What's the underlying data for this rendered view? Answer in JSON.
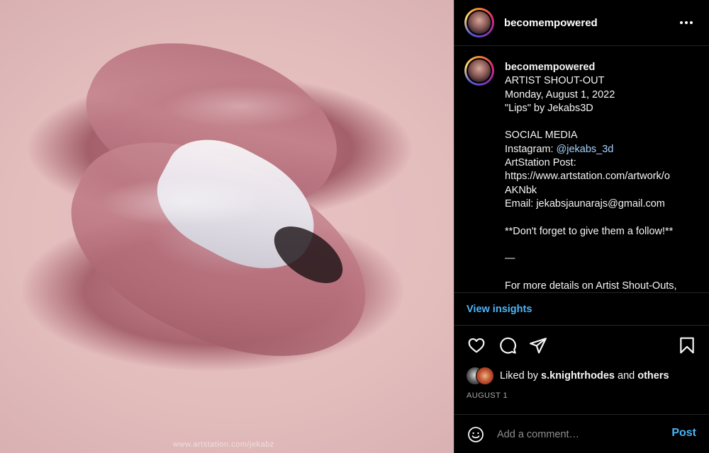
{
  "post": {
    "watermark": "www.artstation.com/jekabz"
  },
  "header": {
    "username": "becomempowered"
  },
  "caption": {
    "username": "becomempowered",
    "lines": [
      "ARTIST SHOUT-OUT",
      "Monday, August 1, 2022",
      "\"Lips\" by Jekabs3D",
      "",
      "SOCIAL MEDIA",
      "Instagram: ",
      "ArtStation Post:",
      "https://www.artstation.com/artwork/o",
      "AKNbk",
      "Email: jekabsjaunarajs@gmail.com",
      "",
      "**Don't forget to give them a follow!**",
      "",
      "—",
      "",
      "For more details on Artist Shout-Outs,"
    ],
    "mention": "@jekabs_3d"
  },
  "insights": {
    "label": "View insights"
  },
  "likes": {
    "prefix": "Liked by ",
    "user": "s.knightrhodes",
    "middle": " and ",
    "others": "others"
  },
  "date": "AUGUST 1",
  "comment": {
    "placeholder": "Add a comment…",
    "post_label": "Post"
  },
  "icons": {
    "more": "more-options-icon",
    "like": "heart-icon",
    "comment": "comment-bubble-icon",
    "share": "paper-plane-icon",
    "save": "bookmark-icon",
    "emoji": "smiley-icon"
  },
  "colors": {
    "link": "#4cb5f9",
    "mention": "#a8d4ff",
    "background": "#000000"
  }
}
